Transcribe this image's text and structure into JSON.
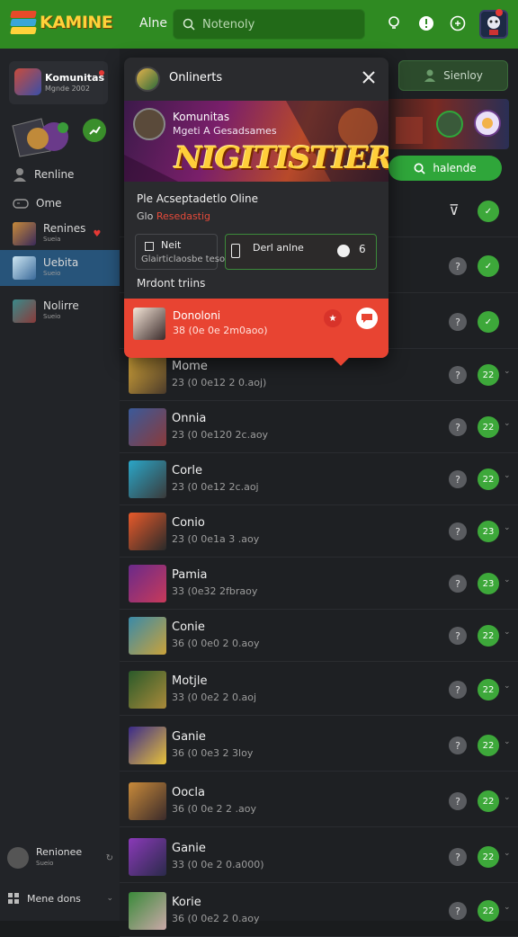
{
  "header": {
    "logo_text": "KAMINE",
    "nav_link": "Alne",
    "search_placeholder": "Notenoly",
    "icons": [
      "lightbulb-icon",
      "alert-icon",
      "chat-icon",
      "profile-avatar"
    ],
    "colors": {
      "bar": "#2f8a22",
      "logo": "#ffd23a"
    }
  },
  "sidebar": {
    "profile": {
      "name": "Komunitas",
      "sub": "Mgnde 2002"
    },
    "items": [
      {
        "label": "Renline",
        "icon": "user-icon"
      },
      {
        "label": "Ome",
        "icon": "controller-icon"
      },
      {
        "label": "Renines",
        "sub": "Sueia",
        "icon": "game-thumb",
        "heart": "♥"
      },
      {
        "label": "Uebita",
        "sub": "Sueio",
        "icon": "game-thumb",
        "active": true
      },
      {
        "label": "Nolirre",
        "sub": "Sueio",
        "icon": "game-thumb"
      }
    ],
    "footer": [
      {
        "label": "Renionee",
        "sub": "Sueio"
      },
      {
        "label": "Mene dons"
      }
    ]
  },
  "right_panel": {
    "button_label": "Sienloy",
    "green_button": "halende"
  },
  "popup": {
    "title": "Onlinerts",
    "banner": {
      "line1": "Komunitas",
      "line2": "Mgeti A Gesadsames",
      "big": "NIGITISTIER"
    },
    "line1": "Ple Acseptadetlo Oline",
    "line2_prefix": "Glo",
    "line2_highlight": "Resedastig",
    "box1": {
      "label": "Neit",
      "sub": "Glairticlaosbe tesoo"
    },
    "box2": {
      "label": "Derl anlne",
      "icon2": "6"
    },
    "section": "Mrdont triins",
    "highlight": {
      "name": "Donoloni",
      "meta": "38 (0e 0e 2m0aoo)"
    }
  },
  "list": [
    {
      "name": "Mome",
      "meta": "23 (0 0e12 2 0.aoj)",
      "ico1": "?",
      "ico2": "22"
    },
    {
      "name": "Onnia",
      "meta": "23 (0 0e120 2c.aoy",
      "ico1": "?",
      "ico2": "22"
    },
    {
      "name": "Corle",
      "meta": "23 (0 0e12 2c.aoj",
      "ico1": "?",
      "ico2": "22"
    },
    {
      "name": "Conio",
      "meta": "23 (0 0e1a 3 .aoy",
      "ico1": "?",
      "ico2": "23"
    },
    {
      "name": "Pamia",
      "meta": "33 (0e32 2fbraoy",
      "ico1": "?",
      "ico2": "23"
    },
    {
      "name": "Conie",
      "meta": "36 (0 0e0 2 0.aoy",
      "ico1": "?",
      "ico2": "22"
    },
    {
      "name": "Motjle",
      "meta": "33 (0 0e2 2 0.aoj",
      "ico1": "?",
      "ico2": "22"
    },
    {
      "name": "Ganie",
      "meta": "36 (0 0e3 2 3loy",
      "ico1": "?",
      "ico2": "22"
    },
    {
      "name": "Oocla",
      "meta": "36 (0 0e 2 2 .aoy",
      "ico1": "?",
      "ico2": "22"
    },
    {
      "name": "Ganie",
      "meta": "33 (0 0e 2 0.a000)",
      "ico1": "?",
      "ico2": "22"
    },
    {
      "name": "Korie",
      "meta": "36 (0 0e2 2 0.aoy",
      "ico1": "?",
      "ico2": "22"
    }
  ]
}
